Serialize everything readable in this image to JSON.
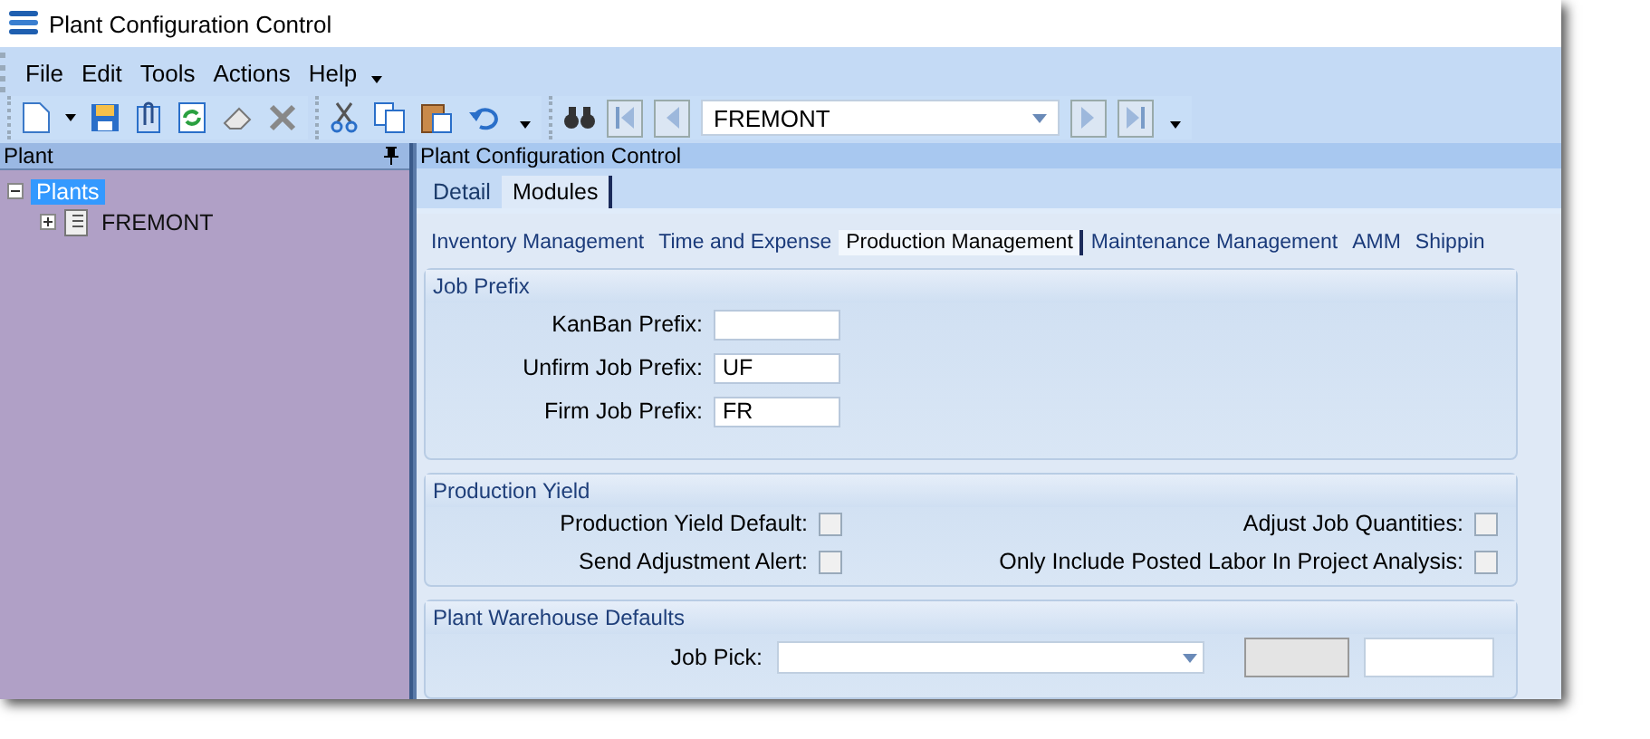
{
  "window": {
    "title": "Plant Configuration Control"
  },
  "menu": [
    "File",
    "Edit",
    "Tools",
    "Actions",
    "Help"
  ],
  "toolbar": {
    "record": "FREMONT"
  },
  "left_panel": {
    "title": "Plant",
    "tree": [
      {
        "label": "Plants",
        "expanded": true,
        "selected": true,
        "children": [
          {
            "label": "FREMONT",
            "expanded": false,
            "selected": false
          }
        ]
      }
    ]
  },
  "main": {
    "title": "Plant Configuration Control",
    "tabs": [
      {
        "label": "Detail",
        "selected": false
      },
      {
        "label": "Modules",
        "selected": true
      }
    ],
    "module_tabs": [
      {
        "label": "Inventory Management",
        "selected": false
      },
      {
        "label": "Time and Expense",
        "selected": false
      },
      {
        "label": "Production Management",
        "selected": true
      },
      {
        "label": "Maintenance Management",
        "selected": false
      },
      {
        "label": "AMM",
        "selected": false
      },
      {
        "label": "Shippin",
        "selected": false
      }
    ],
    "job_prefix": {
      "title": "Job Prefix",
      "fields": [
        {
          "label": "KanBan Prefix:"
        },
        {
          "label": "Unfirm Job Prefix:",
          "value": "UF"
        },
        {
          "label": "Firm Job Prefix:",
          "value": "FR"
        }
      ]
    },
    "production_yield": {
      "title": "Production Yield",
      "options": [
        {
          "label": "Production Yield Default:",
          "checked": false
        },
        {
          "label": "Adjust Job Quantities:",
          "checked": false
        },
        {
          "label": "Send Adjustment Alert:",
          "checked": false
        },
        {
          "label": "Only Include Posted Labor  In Project Analysis:",
          "checked": false
        }
      ]
    },
    "warehouse_defaults": {
      "title": "Plant Warehouse Defaults",
      "field_label": "Job Pick:"
    }
  }
}
